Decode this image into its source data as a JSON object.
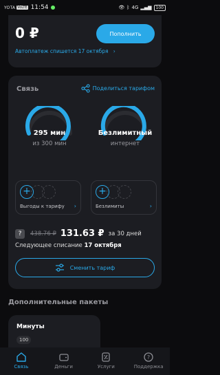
{
  "status_bar": {
    "carrier": "YOTA",
    "network_tag": "VoLTE",
    "time": "11:54",
    "network": "4G",
    "battery": "100"
  },
  "balance": {
    "amount": "0 ₽",
    "topup_label": "Пополнить",
    "autopay_text": "Автоплатеж спишется 17 октября"
  },
  "connection": {
    "title": "Связь",
    "share_label": "Поделиться тарифом",
    "minutes_value": "295 мин",
    "minutes_of": "из 300 мин",
    "minutes_remaining_fraction": 0.983,
    "internet_value": "Безлимитный",
    "internet_sub": "интернет",
    "internet_remaining_fraction": 1.0,
    "packs": [
      {
        "label": "Выгоды к тарифу"
      },
      {
        "label": "Безлимиты"
      }
    ],
    "price_old": "438.76 ₽",
    "price_new": "131.63 ₽",
    "price_period": "за 30 дней",
    "next_charge_label": "Следующее списание",
    "next_charge_date": "17 октября",
    "change_tariff_label": "Сменить тариф"
  },
  "extra": {
    "section_title": "Дополнительные пакеты",
    "minutes_title": "Минуты",
    "minutes_chip": "100"
  },
  "nav": {
    "items": [
      {
        "label": "Связь",
        "icon": "home-icon",
        "active": true
      },
      {
        "label": "Деньги",
        "icon": "wallet-icon",
        "active": false
      },
      {
        "label": "Услуги",
        "icon": "percent-icon",
        "active": false
      },
      {
        "label": "Поддержка",
        "icon": "help-icon",
        "active": false
      }
    ]
  },
  "colors": {
    "accent": "#2aa9e8",
    "background": "#0c0c0e",
    "card": "#1c1d22"
  }
}
